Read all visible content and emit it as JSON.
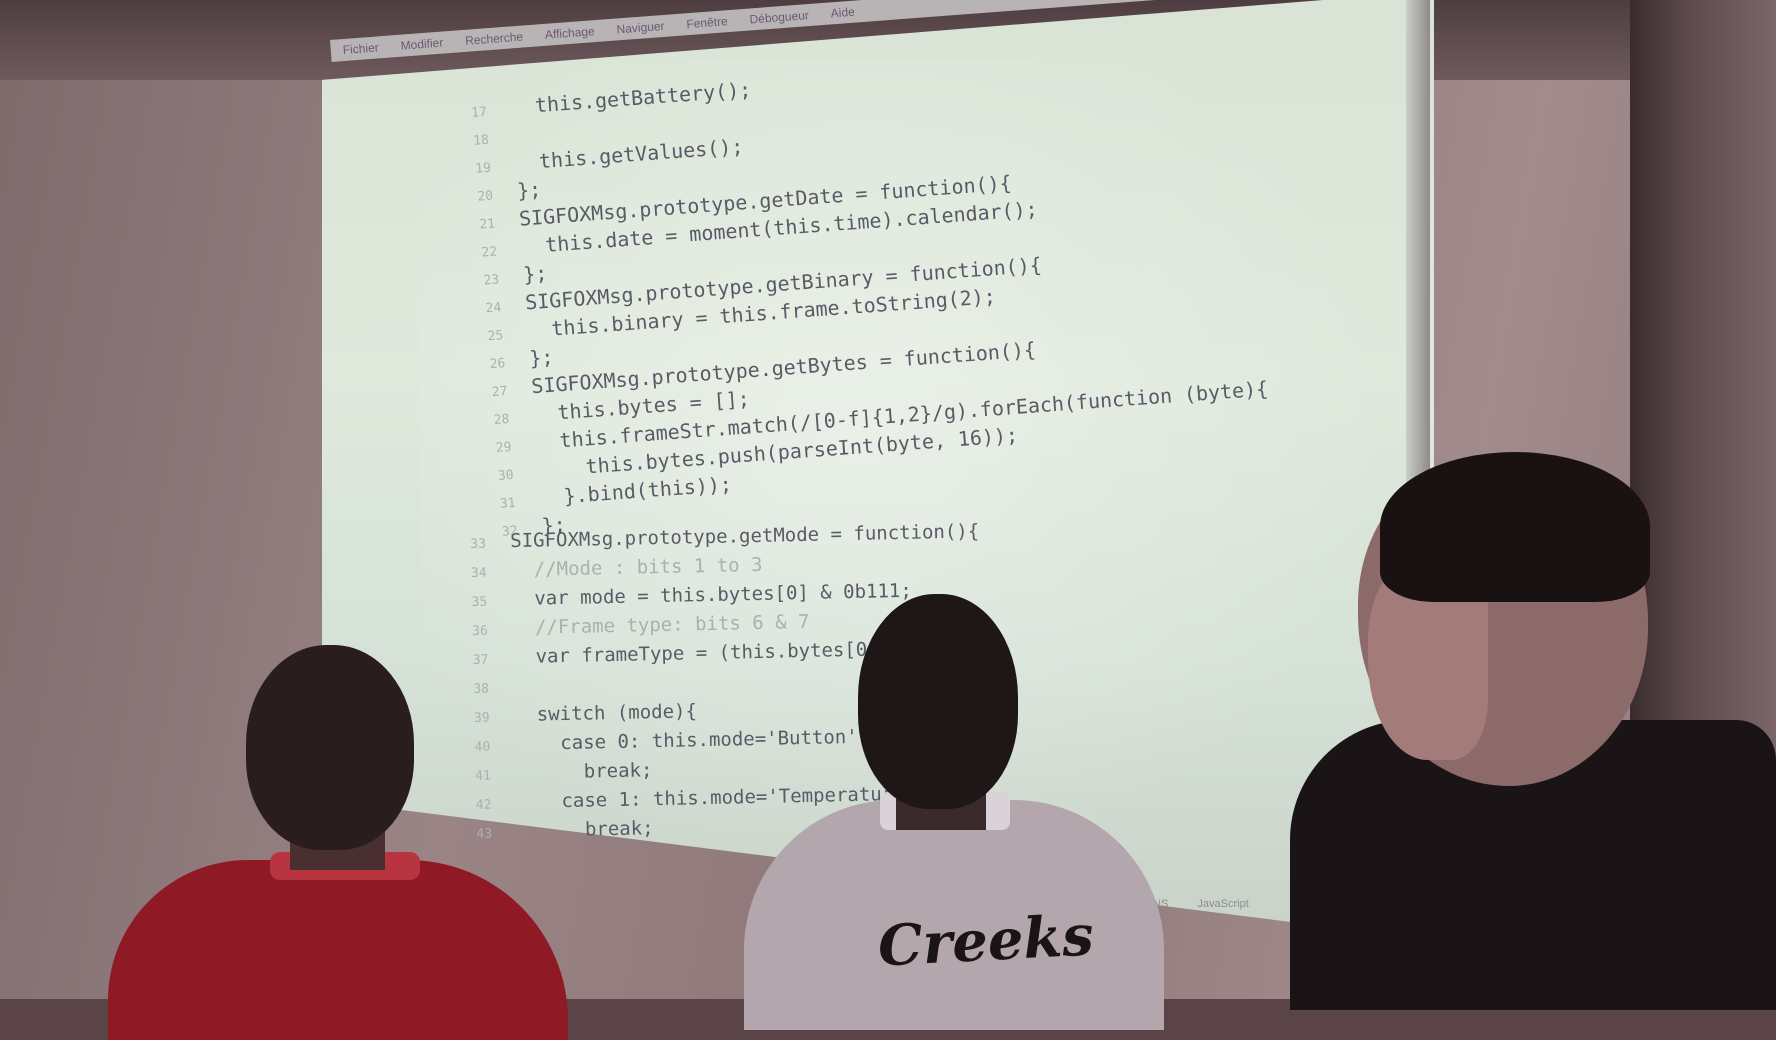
{
  "menubar": [
    "Fichier",
    "Modifier",
    "Recherche",
    "Affichage",
    "Naviguer",
    "Fenêtre",
    "Débogueur",
    "Aide"
  ],
  "code_upper": [
    {
      "n": "17",
      "text": "  this.getBattery();"
    },
    {
      "n": "18",
      "text": ""
    },
    {
      "n": "19",
      "text": "  this.getValues();"
    },
    {
      "n": "20",
      "text": "};"
    },
    {
      "n": "21",
      "text": "SIGFOXMsg.prototype.getDate = function(){"
    },
    {
      "n": "22",
      "text": "  this.date = moment(this.time).calendar();"
    },
    {
      "n": "23",
      "text": "};"
    },
    {
      "n": "24",
      "text": "SIGFOXMsg.prototype.getBinary = function(){"
    },
    {
      "n": "25",
      "text": "  this.binary = this.frame.toString(2);"
    },
    {
      "n": "26",
      "text": "};"
    },
    {
      "n": "27",
      "text": "SIGFOXMsg.prototype.getBytes = function(){"
    },
    {
      "n": "28",
      "text": "  this.bytes = [];"
    },
    {
      "n": "29",
      "text": "  this.frameStr.match(/[0-f]{1,2}/g).forEach(function (byte){"
    },
    {
      "n": "30",
      "text": "    this.bytes.push(parseInt(byte, 16));"
    },
    {
      "n": "31",
      "text": "  }.bind(this));"
    },
    {
      "n": "32",
      "text": "};"
    }
  ],
  "code_lower": [
    {
      "n": "33",
      "text": "SIGFOXMsg.prototype.getMode = function(){",
      "comment": false
    },
    {
      "n": "34",
      "text": "  //Mode : bits 1 to 3",
      "comment": true
    },
    {
      "n": "35",
      "text": "  var mode = this.bytes[0] & 0b111;",
      "comment": false
    },
    {
      "n": "36",
      "text": "  //Frame type: bits 6 & 7",
      "comment": true
    },
    {
      "n": "37",
      "text": "  var frameType = (this.bytes[0] >>",
      "comment": false
    },
    {
      "n": "38",
      "text": "",
      "comment": false
    },
    {
      "n": "39",
      "text": "  switch (mode){",
      "comment": false
    },
    {
      "n": "40",
      "text": "    case 0: this.mode='Button';",
      "comment": false
    },
    {
      "n": "41",
      "text": "      break;",
      "comment": false
    },
    {
      "n": "42",
      "text": "    case 1: this.mode='Temperature'",
      "comment": false
    },
    {
      "n": "43",
      "text": "      break;",
      "comment": false
    }
  ],
  "statusbar": {
    "ins": "INS",
    "language": "JavaScript"
  },
  "shirt_text": "Creeks"
}
